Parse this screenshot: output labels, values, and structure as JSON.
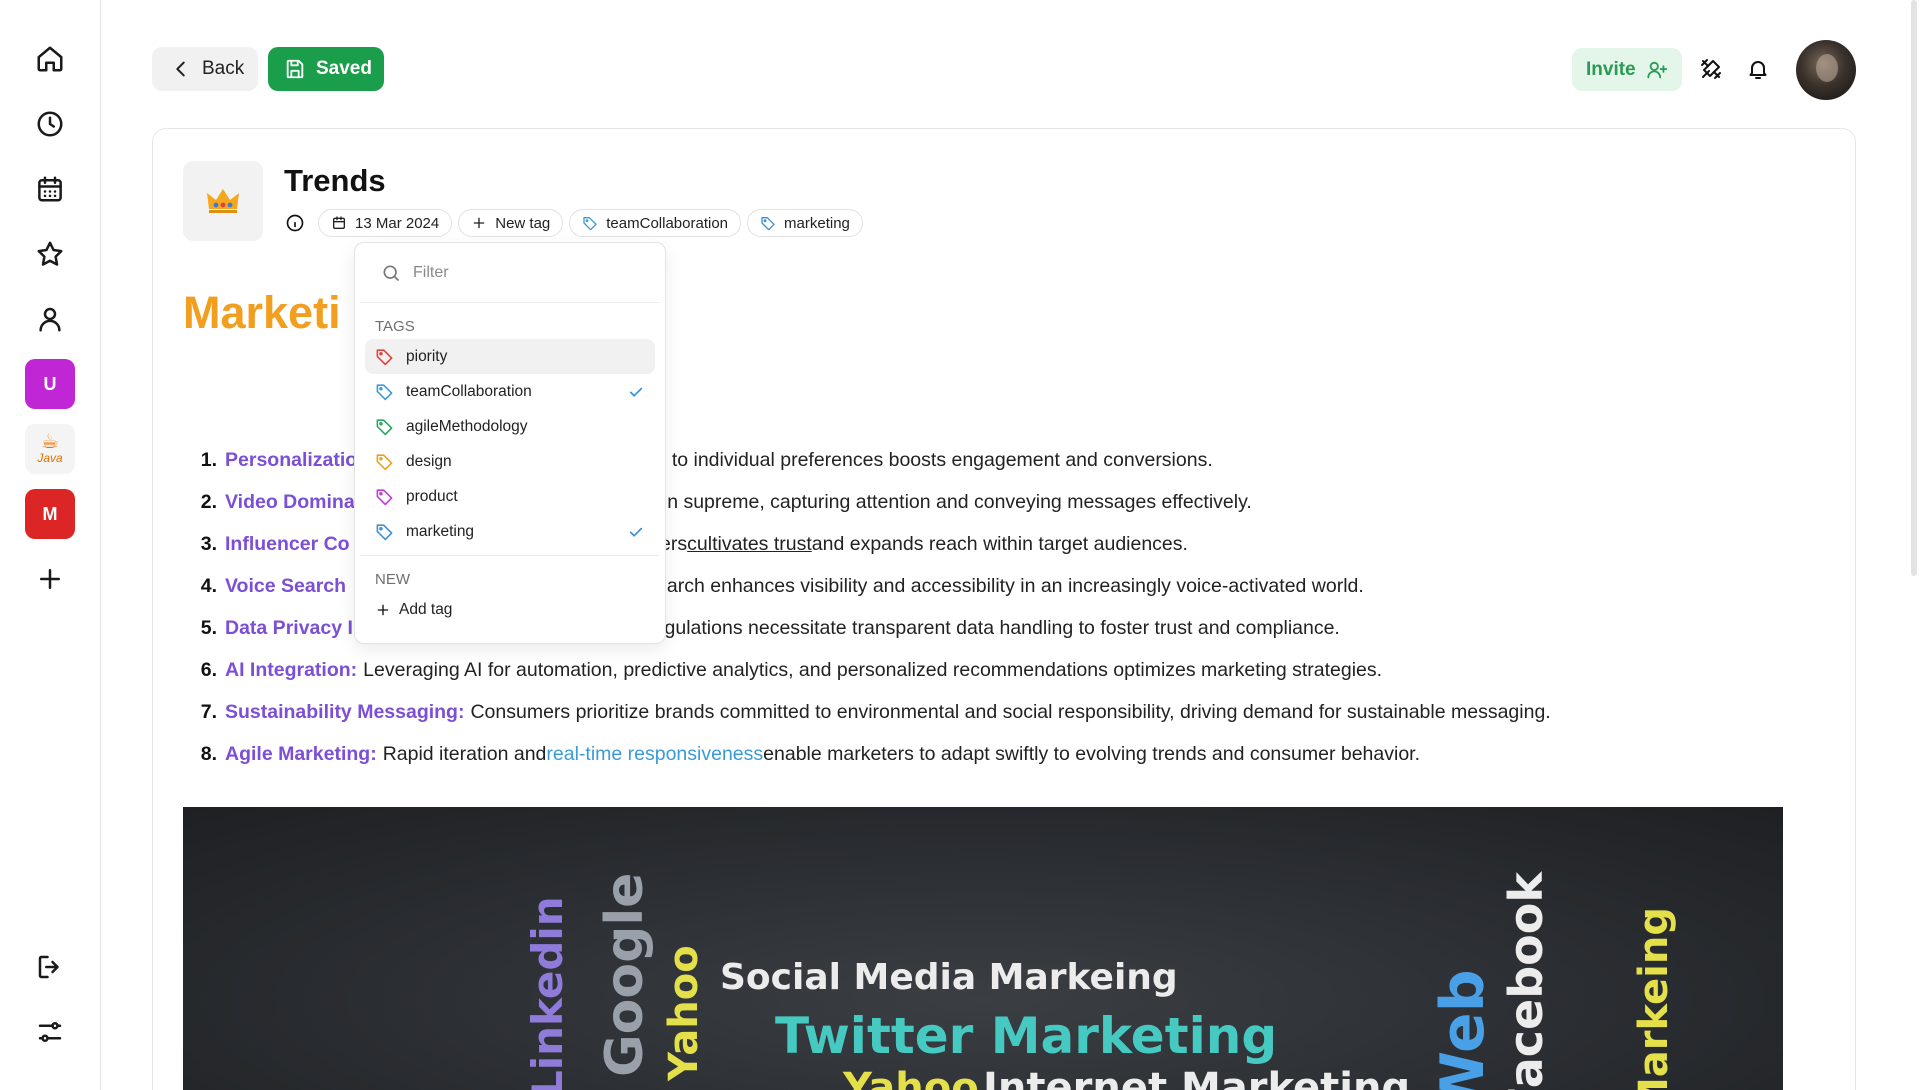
{
  "header": {
    "back_label": "Back",
    "saved_label": "Saved",
    "invite_label": "Invite"
  },
  "sidebar": {
    "icons": [
      "home-icon",
      "clock-icon",
      "calendar-icon",
      "star-icon",
      "user-icon"
    ],
    "workspaces": [
      {
        "letter": "U",
        "color": "#c026d3"
      },
      {
        "letter": "Java",
        "color": "#e76f00"
      },
      {
        "letter": "M",
        "color": "#dc2626"
      }
    ],
    "bottom_icons": [
      "logout-icon",
      "settings-sliders-icon"
    ]
  },
  "document": {
    "icon": "crown-icon",
    "title": "Trends",
    "date": "13 Mar 2024",
    "new_tag_label": "New tag",
    "tags": [
      {
        "label": "teamCollaboration",
        "color": "#3a9bd8"
      },
      {
        "label": "marketing",
        "color": "#3a8fd6"
      }
    ],
    "heading": "Marketi",
    "list": [
      {
        "num": "1.",
        "keyword": "Personalizatio",
        "text": "nces to individual preferences boosts engagement and conversions."
      },
      {
        "num": "2.",
        "keyword": "Video Domina",
        "text": "reign supreme, capturing attention and conveying messages effectively."
      },
      {
        "num": "3.",
        "keyword": "Influencer Co",
        "text_pre": "encers ",
        "text_link": "cultivates trust ",
        "text_post": "and expands reach within target audiences."
      },
      {
        "num": "4.",
        "keyword": "Voice Search",
        "text": "e search enhances visibility and accessibility in an increasingly voice-activated world."
      },
      {
        "num": "5.",
        "keyword": "Data Privacy I",
        "text": "d regulations necessitate transparent data handling to foster trust and compliance."
      },
      {
        "num": "6.",
        "keyword": "AI Integration:",
        "text": "Leveraging AI for automation, predictive analytics, and personalized recommendations optimizes marketing strategies."
      },
      {
        "num": "7.",
        "keyword": "Sustainability Messaging:",
        "text": "Consumers prioritize brands committed to environmental and social responsibility, driving demand for sustainable messaging."
      },
      {
        "num": "8.",
        "keyword": "Agile Marketing:",
        "text_pre": "Rapid iteration and ",
        "text_link": "real-time responsiveness",
        "text_post": " enable marketers to adapt swiftly to evolving trends and consumer behavior."
      }
    ],
    "hero_words": {
      "linkedin": "Linkedin",
      "google": "Google",
      "yahoo_v": "Yahoo",
      "social": "Social Media Markeing",
      "twitter": "Twitter Marketing",
      "yahoo_h": "Yahoo",
      "internet": "Internet Marketing",
      "web": "Web",
      "facebook": "Facebook",
      "markeing": "Markeing"
    }
  },
  "tag_dropdown": {
    "filter_placeholder": "Filter",
    "tags_section": "TAGS",
    "items": [
      {
        "label": "piority",
        "color": "#e0413a",
        "checked": false
      },
      {
        "label": "teamCollaboration",
        "color": "#3a9bd8",
        "checked": true
      },
      {
        "label": "agileMethodology",
        "color": "#2aa55b",
        "checked": false
      },
      {
        "label": "design",
        "color": "#e8a21a",
        "checked": false
      },
      {
        "label": "product",
        "color": "#c03ad6",
        "checked": false
      },
      {
        "label": "marketing",
        "color": "#3a8fd6",
        "checked": true
      }
    ],
    "new_section": "NEW",
    "add_tag_label": "Add tag"
  }
}
